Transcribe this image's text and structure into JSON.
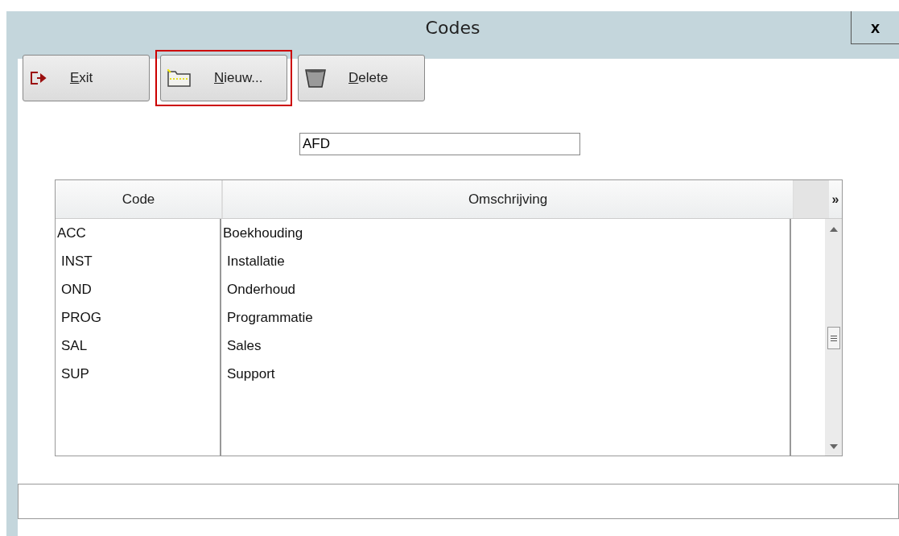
{
  "window": {
    "title": "Codes",
    "close": "x"
  },
  "toolbar": [
    {
      "label": "Exit",
      "kind": "exit",
      "highlighted": false
    },
    {
      "label": "Nieuw...",
      "kind": "new",
      "highlighted": true
    },
    {
      "label": "Delete",
      "kind": "delete",
      "highlighted": false
    }
  ],
  "field": {
    "value": "AFD"
  },
  "table": {
    "columns": [
      "Code",
      "Omschrijving"
    ],
    "more": "»",
    "rows": [
      {
        "code": "ACC",
        "description": "Boekhouding"
      },
      {
        "code": "INST",
        "description": "Installatie"
      },
      {
        "code": "OND",
        "description": "Onderhoud"
      },
      {
        "code": "PROG",
        "description": "Programmatie"
      },
      {
        "code": "SAL",
        "description": "Sales"
      },
      {
        "code": "SUP",
        "description": "Support"
      }
    ]
  }
}
